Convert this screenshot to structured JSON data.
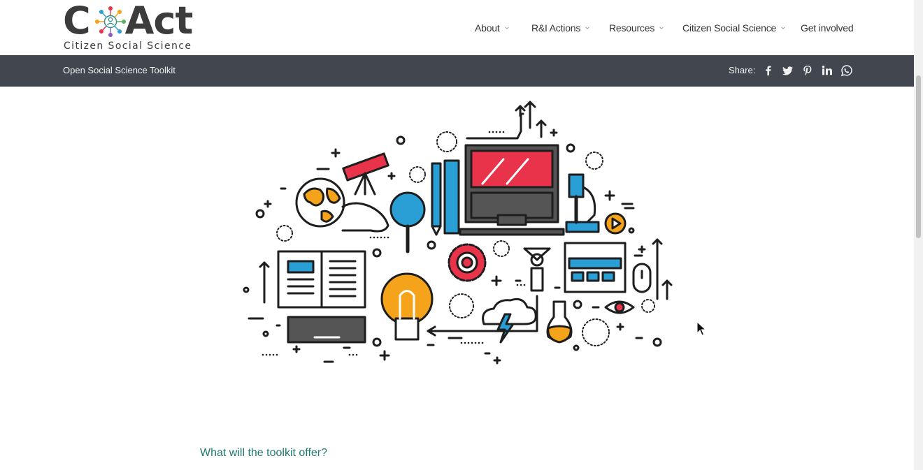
{
  "brand": {
    "wordmark_left": "C",
    "wordmark_right": "Act",
    "tagline": "Citizen Social Science",
    "emblem_icon": "network-people-icon"
  },
  "nav": {
    "items": [
      {
        "label": "About",
        "has_dropdown": true
      },
      {
        "label": "R&I Actions",
        "has_dropdown": true
      },
      {
        "label": "Resources",
        "has_dropdown": true
      },
      {
        "label": "Citizen Social Science",
        "has_dropdown": true
      },
      {
        "label": "Get involved",
        "has_dropdown": false
      }
    ]
  },
  "subbar": {
    "title": "Open Social Science Toolkit",
    "share_label": "Share:",
    "share_icons": [
      "facebook-icon",
      "twitter-icon",
      "pinterest-icon",
      "linkedin-icon",
      "whatsapp-icon"
    ]
  },
  "hero": {
    "illustration": "science-tools-illustration"
  },
  "content": {
    "section_heading": "What will the toolkit offer?"
  },
  "colors": {
    "subbar_bg": "#41464f",
    "heading_teal": "#1f7a72",
    "accent_red": "#e8334a",
    "accent_blue": "#2a9fd6",
    "accent_orange": "#f5a31a"
  }
}
